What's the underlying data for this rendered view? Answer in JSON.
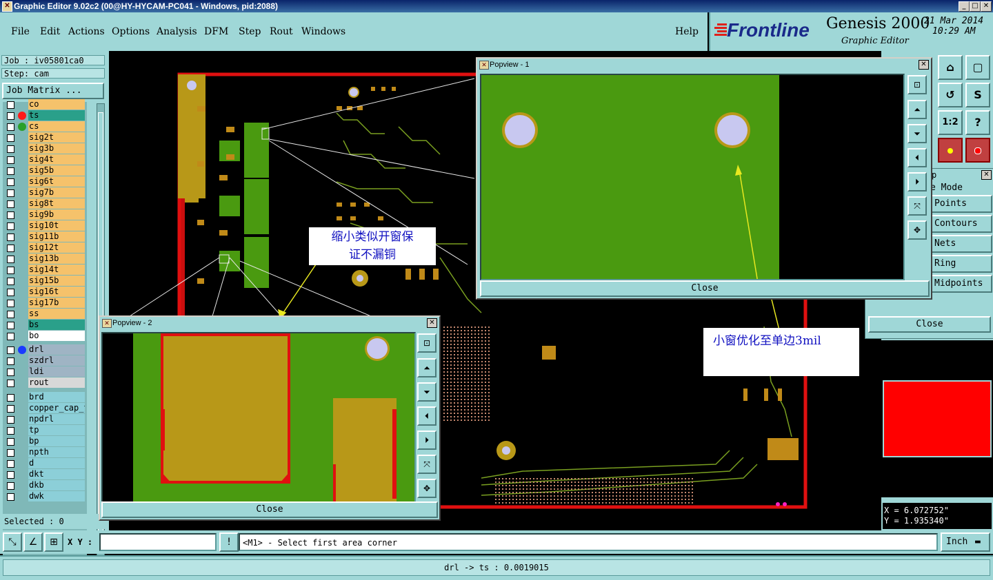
{
  "window": {
    "title": "Graphic Editor 9.02c2 (00@HY-HYCAM-PC041 - Windows, pid:2088)",
    "controls": [
      "_",
      "□",
      "✕"
    ]
  },
  "menu": {
    "items": [
      "File",
      "Edit",
      "Actions",
      "Options",
      "Analysis",
      "DFM",
      "Step",
      "Rout",
      "Windows"
    ],
    "help": "Help"
  },
  "branding": {
    "logo": "Frontline",
    "product": "Genesis 2000",
    "subtitle": "Graphic Editor",
    "date": "21 Mar 2014",
    "time": "10:29 AM"
  },
  "job": {
    "job_label": "Job : iv05801ca0",
    "step_label": "Step: cam",
    "matrix_button": "Job Matrix ..."
  },
  "layers": {
    "group1": [
      {
        "name": "co",
        "color": "#f5c26b"
      },
      {
        "name": "ts",
        "color": "#2aa08a",
        "dot": "#ff1a1a",
        "active": true
      },
      {
        "name": "cs",
        "color": "#f5c26b",
        "dot": "#2aa02a"
      },
      {
        "name": "sig2t",
        "color": "#f5c26b"
      },
      {
        "name": "sig3b",
        "color": "#f5c26b"
      },
      {
        "name": "sig4t",
        "color": "#f5c26b"
      },
      {
        "name": "sig5b",
        "color": "#f5c26b"
      },
      {
        "name": "sig6t",
        "color": "#f5c26b"
      },
      {
        "name": "sig7b",
        "color": "#f5c26b"
      },
      {
        "name": "sig8t",
        "color": "#f5c26b"
      },
      {
        "name": "sig9b",
        "color": "#f5c26b"
      },
      {
        "name": "sig10t",
        "color": "#f5c26b"
      },
      {
        "name": "sig11b",
        "color": "#f5c26b"
      },
      {
        "name": "sig12t",
        "color": "#f5c26b"
      },
      {
        "name": "sig13b",
        "color": "#f5c26b"
      },
      {
        "name": "sig14t",
        "color": "#f5c26b"
      },
      {
        "name": "sig15b",
        "color": "#f5c26b"
      },
      {
        "name": "sig16t",
        "color": "#f5c26b"
      },
      {
        "name": "sig17b",
        "color": "#f5c26b"
      },
      {
        "name": "ss",
        "color": "#f5c26b"
      },
      {
        "name": "bs",
        "color": "#2aa08a"
      },
      {
        "name": "bo",
        "color": "#ffffff"
      }
    ],
    "group2": [
      {
        "name": "drl",
        "color": "#9fb4c4",
        "dot": "#1a3aff"
      },
      {
        "name": "szdrl",
        "color": "#9fb4c4"
      },
      {
        "name": "ldi",
        "color": "#9fb4c4"
      },
      {
        "name": "rout",
        "color": "#d8d8d8"
      }
    ],
    "group3": [
      {
        "name": "brd",
        "color": "#8ccfd8"
      },
      {
        "name": "copper_cap_t",
        "color": "#8ccfd8"
      },
      {
        "name": "npdrl",
        "color": "#8ccfd8"
      },
      {
        "name": "tp",
        "color": "#8ccfd8"
      },
      {
        "name": "bp",
        "color": "#8ccfd8"
      },
      {
        "name": "npth",
        "color": "#8ccfd8"
      },
      {
        "name": "d",
        "color": "#8ccfd8"
      },
      {
        "name": "dkt",
        "color": "#8ccfd8"
      },
      {
        "name": "dkb",
        "color": "#8ccfd8"
      },
      {
        "name": "dwk",
        "color": "#8ccfd8"
      }
    ]
  },
  "selected": "Selected : 0",
  "popview1": {
    "title": "Popview - 1",
    "close": "Close"
  },
  "popview2": {
    "title": "Popview - 2",
    "close": "Close"
  },
  "snap_popup": {
    "title_fragment": "p",
    "mode_fragment": "e Mode",
    "items": [
      "Points",
      "Contours",
      "Nets",
      "Ring",
      "Midpoints"
    ],
    "close": "Close"
  },
  "right_tools": [
    "home-icon",
    "frame-icon",
    "swap-icon",
    "route-icon",
    "ratio-icon",
    "help-icon",
    "layers-color-icon",
    "layers-color-icon-2"
  ],
  "right_tool_labels": {
    "ratio": "1:2",
    "help": "?"
  },
  "coords": {
    "x": "X = 6.072752\"",
    "y": "Y = 1.935340\""
  },
  "annotations": {
    "left_note": "缩小类似开窗保\n证不漏铜",
    "right_note": "小窗优化至单边3mil"
  },
  "command": {
    "xy_label": "X Y :",
    "xy_value": "",
    "prompt": "<M1> - Select first area corner",
    "units": "Inch"
  },
  "status": "drl -> ts : 0.0019015"
}
